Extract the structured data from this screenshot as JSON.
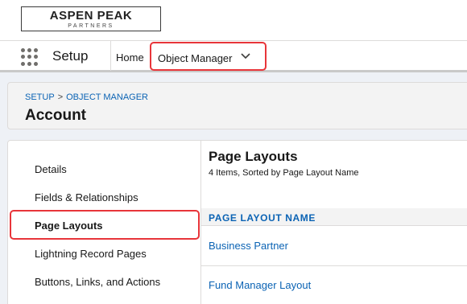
{
  "logo": {
    "name": "ASPEN PEAK",
    "tagline": "PARTNERS"
  },
  "nav": {
    "app_launcher_icon": "waffle-grid-icon",
    "app_name": "Setup",
    "home_label": "Home",
    "object_manager_label": "Object Manager",
    "object_manager_icon": "chevron-down-icon"
  },
  "breadcrumb": {
    "setup": "SETUP",
    "separator": ">",
    "object_manager": "OBJECT MANAGER"
  },
  "page_title": "Account",
  "sidebar": {
    "items": [
      {
        "label": "Details",
        "active": false
      },
      {
        "label": "Fields & Relationships",
        "active": false
      },
      {
        "label": "Page Layouts",
        "active": true
      },
      {
        "label": "Lightning Record Pages",
        "active": false
      },
      {
        "label": "Buttons, Links, and Actions",
        "active": false
      }
    ]
  },
  "main": {
    "title": "Page Layouts",
    "subtitle": "4 Items, Sorted by Page Layout Name",
    "column_header": "PAGE LAYOUT NAME",
    "rows": [
      {
        "name": "Business Partner"
      },
      {
        "name": "Fund Manager Layout"
      }
    ]
  },
  "colors": {
    "link": "#0b63b4",
    "highlight": "#e8353a",
    "workspace": "#eef1f6"
  }
}
